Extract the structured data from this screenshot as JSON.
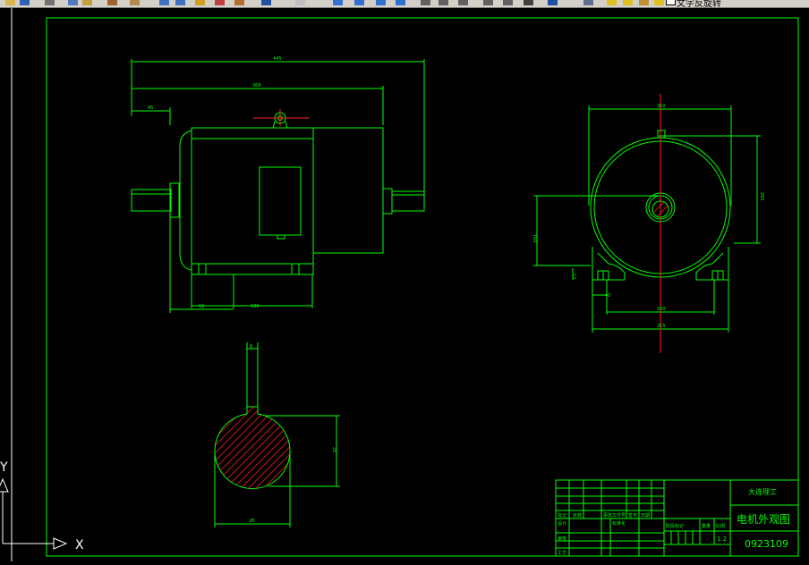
{
  "toolbar": {
    "layer_label": "文字反旋转"
  },
  "ucs": {
    "x_label": "X",
    "y_label": "Y"
  },
  "drawing": {
    "front_view": {
      "dim_top": "445",
      "dim_second": "368",
      "dim_left": "45",
      "dim_bottom_left": "52",
      "dim_bottom_right": "180"
    },
    "side_view": {
      "dim_top": "310",
      "dim_right": "265",
      "dim_left": "160",
      "dim_small_left": "12",
      "dim_bottom_inner": "40",
      "dim_bottom_mid": "160",
      "dim_bottom": "215"
    },
    "section_view": {
      "dim_key": "8",
      "dim_height": "25",
      "dim_width": "28"
    }
  },
  "title_block": {
    "school": "大连理工",
    "title": "电机外观图",
    "number": "0923109",
    "scale": "1:2",
    "label_mark": "标记",
    "label_count": "处数",
    "label_doc": "更改文件号",
    "label_sign": "签字",
    "label_date": "日期",
    "label_design": "设计",
    "label_std": "标准化",
    "label_review": "审核",
    "label_craft": "工艺",
    "label_stage": "阶段标记",
    "label_weight": "重量",
    "label_ratio": "比例"
  }
}
